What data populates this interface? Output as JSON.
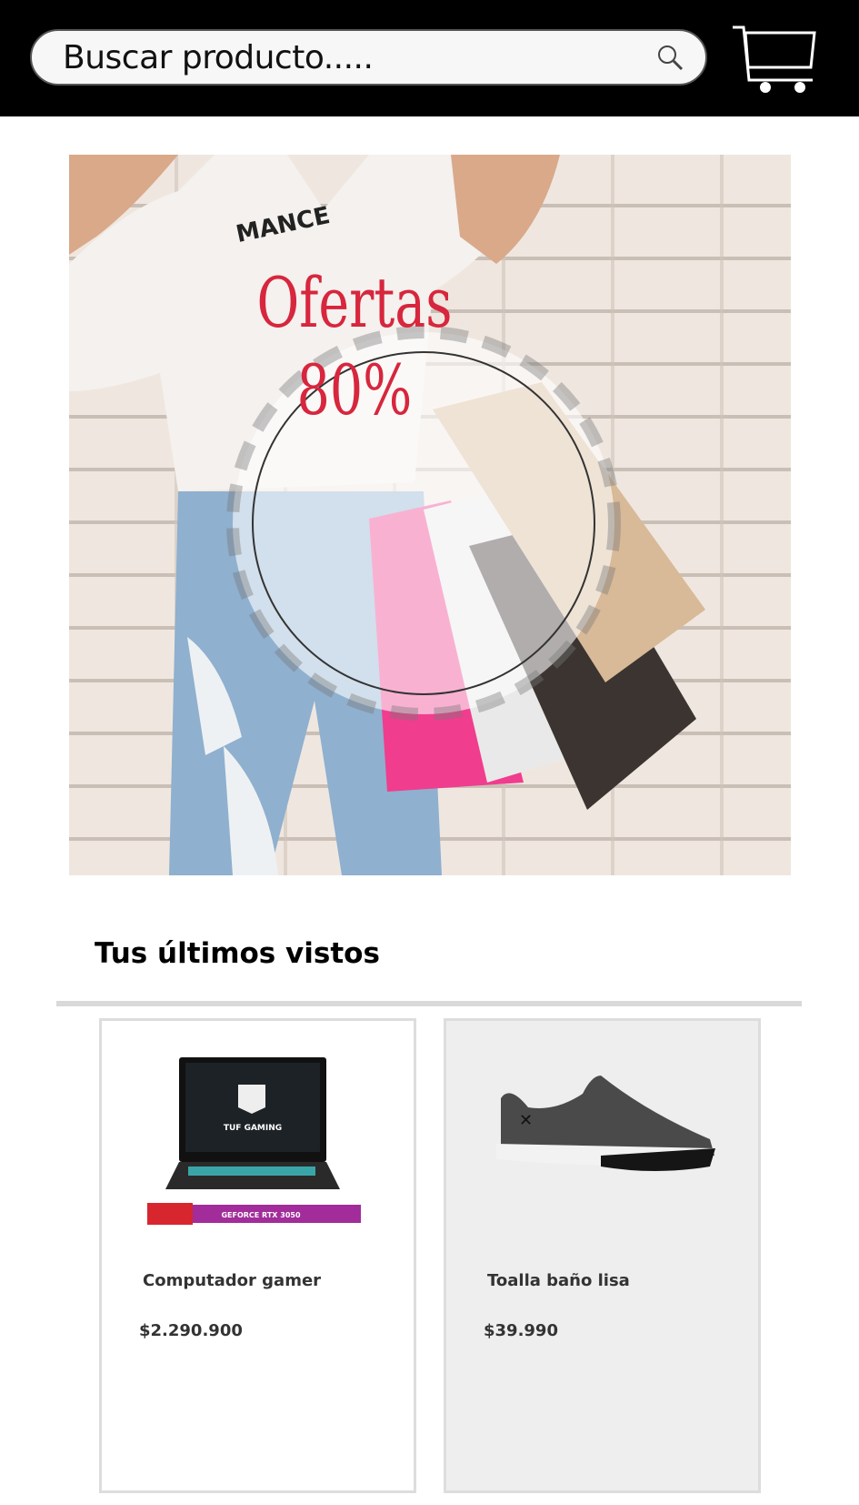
{
  "header": {
    "search_placeholder": "Buscar producto.....",
    "search_icon": "search-icon",
    "cart_icon": "cart-icon"
  },
  "banner": {
    "line1": "Ofertas",
    "line2": "80%",
    "shirt_text": "MANCE"
  },
  "recent": {
    "title": "Tus últimos vistos",
    "products": [
      {
        "name": "Computador gamer",
        "price": "$2.290.900",
        "image": "laptop",
        "screen_text": "TUF GAMING",
        "label_text": "GEFORCE RTX 3050"
      },
      {
        "name": "Toalla baño lisa",
        "price": "$39.990",
        "image": "shoe"
      }
    ]
  },
  "colors": {
    "accent": "#d7263d",
    "header_bg": "#000000",
    "divider": "#d9d9d9"
  }
}
